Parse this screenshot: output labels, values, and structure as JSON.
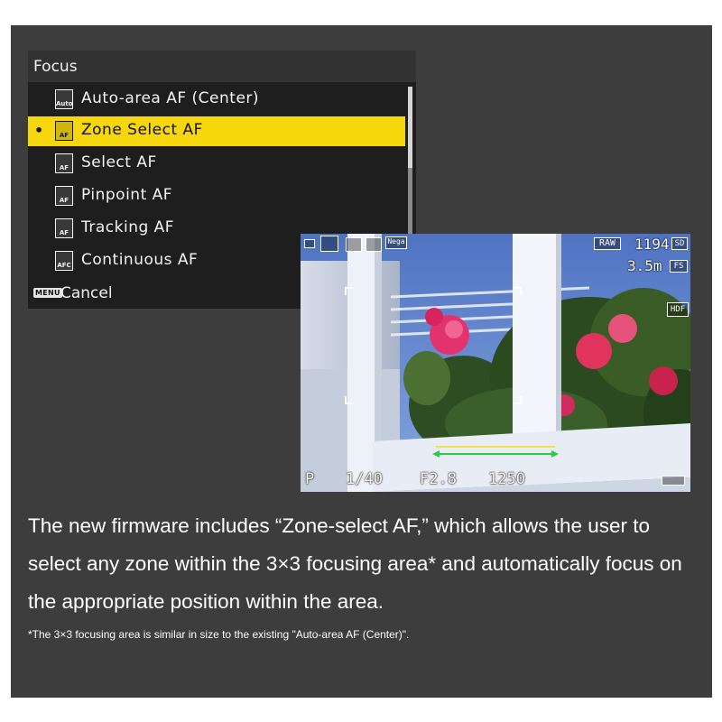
{
  "menu": {
    "title": "Focus",
    "items": [
      {
        "label": "Auto-area AF (Center)",
        "icon": "auto-area-af-icon",
        "icon_text": "Auto",
        "selected": false
      },
      {
        "label": "Zone Select AF",
        "icon": "zone-select-af-icon",
        "icon_text": "AF",
        "selected": true
      },
      {
        "label": "Select AF",
        "icon": "select-af-icon",
        "icon_text": "AF",
        "selected": false
      },
      {
        "label": "Pinpoint AF",
        "icon": "pinpoint-af-icon",
        "icon_text": "AF",
        "selected": false
      },
      {
        "label": "Tracking AF",
        "icon": "tracking-af-icon",
        "icon_text": "AF",
        "selected": false
      },
      {
        "label": "Continuous AF",
        "icon": "continuous-af-icon",
        "icon_text": "AFC",
        "selected": false
      }
    ],
    "bullet": "•",
    "cancel_key": "MENU",
    "cancel_label": "Cancel",
    "highlight_color": "#f6d60d"
  },
  "liveview": {
    "raw_label": "RAW",
    "shots_remaining": "1194",
    "card_label": "SD",
    "distance": "3.5m",
    "fs_label": "FS",
    "hdf_label": "HDF",
    "exposure_mode": "P",
    "shutter_speed": "1/40",
    "aperture": "F2.8",
    "iso": "1250",
    "icons": [
      "screen-mode-icon",
      "focus-mode-icon",
      "af-area-icon",
      "zoom-icon",
      "nega-icon",
      "battery-icon"
    ],
    "nega_label": "Nega"
  },
  "description": {
    "body": "The new firmware includes “Zone-select AF,” which allows the user to select any zone within the 3×3 focusing area* and automatically focus on the appropriate position within the area.",
    "footnote": "*The 3×3 focusing area is similar in size to the existing \"Auto-area AF (Center)\"."
  }
}
